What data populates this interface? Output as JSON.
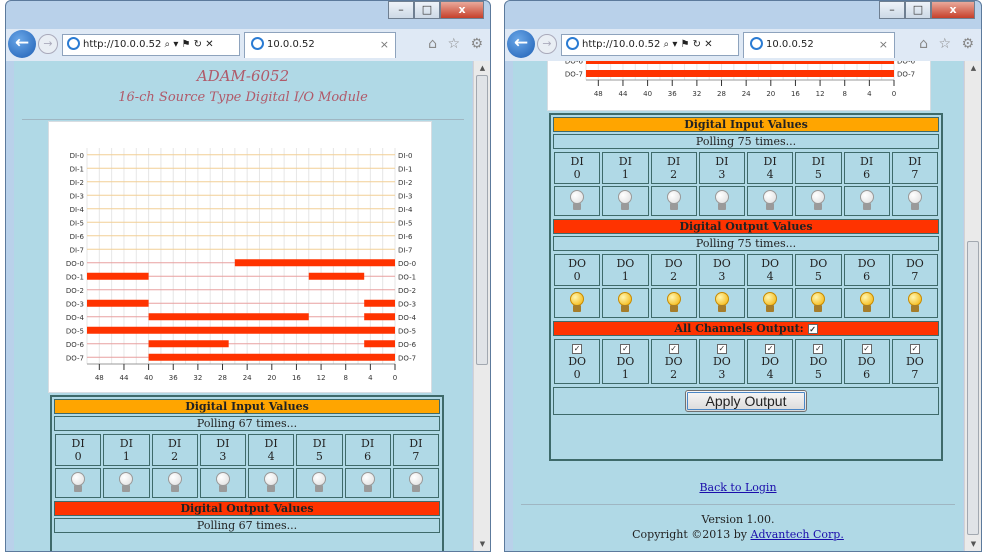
{
  "left": {
    "window_controls": {
      "minimize": "–",
      "maximize": "□",
      "close": "x"
    },
    "address": "http://10.0.0.52",
    "address_tail": "⌕ ▾ ⚑ ↻ ✕",
    "tab_title": "10.0.0.52",
    "tab_close": "×",
    "toolbar_icons": "⌂ ☆ ⚙",
    "page_title": "ADAM-6052",
    "page_subtitle": "16-ch Source Type Digital I/O Module",
    "di_header": "Digital Input Values",
    "polling": "Polling 67 times...",
    "do_header": "Digital Output Values",
    "do_polling": "Polling 67 times..."
  },
  "right": {
    "window_controls": {
      "minimize": "–",
      "maximize": "□",
      "close": "x"
    },
    "address": "http://10.0.0.52",
    "address_tail": "⌕ ▾ ⚑ ↻ ✕",
    "tab_title": "10.0.0.52",
    "tab_close": "×",
    "toolbar_icons": "⌂ ☆ ⚙",
    "di_header": "Digital Input Values",
    "polling": "Polling 75 times...",
    "do_header": "Digital Output Values",
    "do_polling": "Polling 75 times...",
    "all_channels": "All Channels Output:",
    "apply_button": "Apply Output",
    "back_link": "Back to Login",
    "version": "Version 1.00.",
    "copyright_prefix": "Copyright ©2013 by ",
    "copyright_link": "Advantech Corp."
  },
  "channels": {
    "di": [
      {
        "t": "DI",
        "n": "0"
      },
      {
        "t": "DI",
        "n": "1"
      },
      {
        "t": "DI",
        "n": "2"
      },
      {
        "t": "DI",
        "n": "3"
      },
      {
        "t": "DI",
        "n": "4"
      },
      {
        "t": "DI",
        "n": "5"
      },
      {
        "t": "DI",
        "n": "6"
      },
      {
        "t": "DI",
        "n": "7"
      }
    ],
    "do": [
      {
        "t": "DO",
        "n": "0"
      },
      {
        "t": "DO",
        "n": "1"
      },
      {
        "t": "DO",
        "n": "2"
      },
      {
        "t": "DO",
        "n": "3"
      },
      {
        "t": "DO",
        "n": "4"
      },
      {
        "t": "DO",
        "n": "5"
      },
      {
        "t": "DO",
        "n": "6"
      },
      {
        "t": "DO",
        "n": "7"
      }
    ],
    "di_state": [
      false,
      false,
      false,
      false,
      false,
      false,
      false,
      false
    ],
    "do_state": [
      true,
      true,
      true,
      true,
      true,
      true,
      true,
      true
    ],
    "do_checked": [
      true,
      true,
      true,
      true,
      true,
      true,
      true,
      true
    ]
  },
  "chart": {
    "signals": [
      "DI-0",
      "DI-1",
      "DI-2",
      "DI-3",
      "DI-4",
      "DI-5",
      "DI-6",
      "DI-7",
      "DO-0",
      "DO-1",
      "DO-2",
      "DO-3",
      "DO-4",
      "DO-5",
      "DO-6",
      "DO-7"
    ],
    "x_ticks": [
      "48",
      "44",
      "40",
      "36",
      "32",
      "28",
      "24",
      "20",
      "16",
      "12",
      "8",
      "4",
      "0"
    ],
    "x_range": [
      50,
      0
    ],
    "colors": {
      "di_line": "#f2cf95",
      "do_line": "#e8a0a0",
      "bar": "#ff3300",
      "grid": "#e6e6e6"
    },
    "high_intervals": {
      "DO-0": [
        [
          26,
          0
        ]
      ],
      "DO-1": [
        [
          50,
          40
        ],
        [
          14,
          5
        ]
      ],
      "DO-3": [
        [
          50,
          40
        ],
        [
          5,
          0
        ]
      ],
      "DO-4": [
        [
          40,
          14
        ],
        [
          5,
          0
        ]
      ],
      "DO-5": [
        [
          50,
          0
        ]
      ],
      "DO-6": [
        [
          40,
          27
        ],
        [
          5,
          0
        ]
      ],
      "DO-7": [
        [
          40,
          0
        ]
      ]
    }
  },
  "chart_right_visible": {
    "signals": [
      "DO-6",
      "DO-7"
    ],
    "x_ticks": [
      "48",
      "44",
      "40",
      "36",
      "32",
      "28",
      "24",
      "20",
      "16",
      "12",
      "8",
      "4",
      "0"
    ],
    "high_intervals": {
      "DO-6": [
        [
          50,
          0
        ]
      ],
      "DO-7": [
        [
          50,
          0
        ]
      ]
    }
  },
  "icons": {
    "back": "back-arrow-icon",
    "forward": "forward-arrow-icon",
    "ie": "ie-logo-icon",
    "bulb": "light-bulb-icon"
  }
}
